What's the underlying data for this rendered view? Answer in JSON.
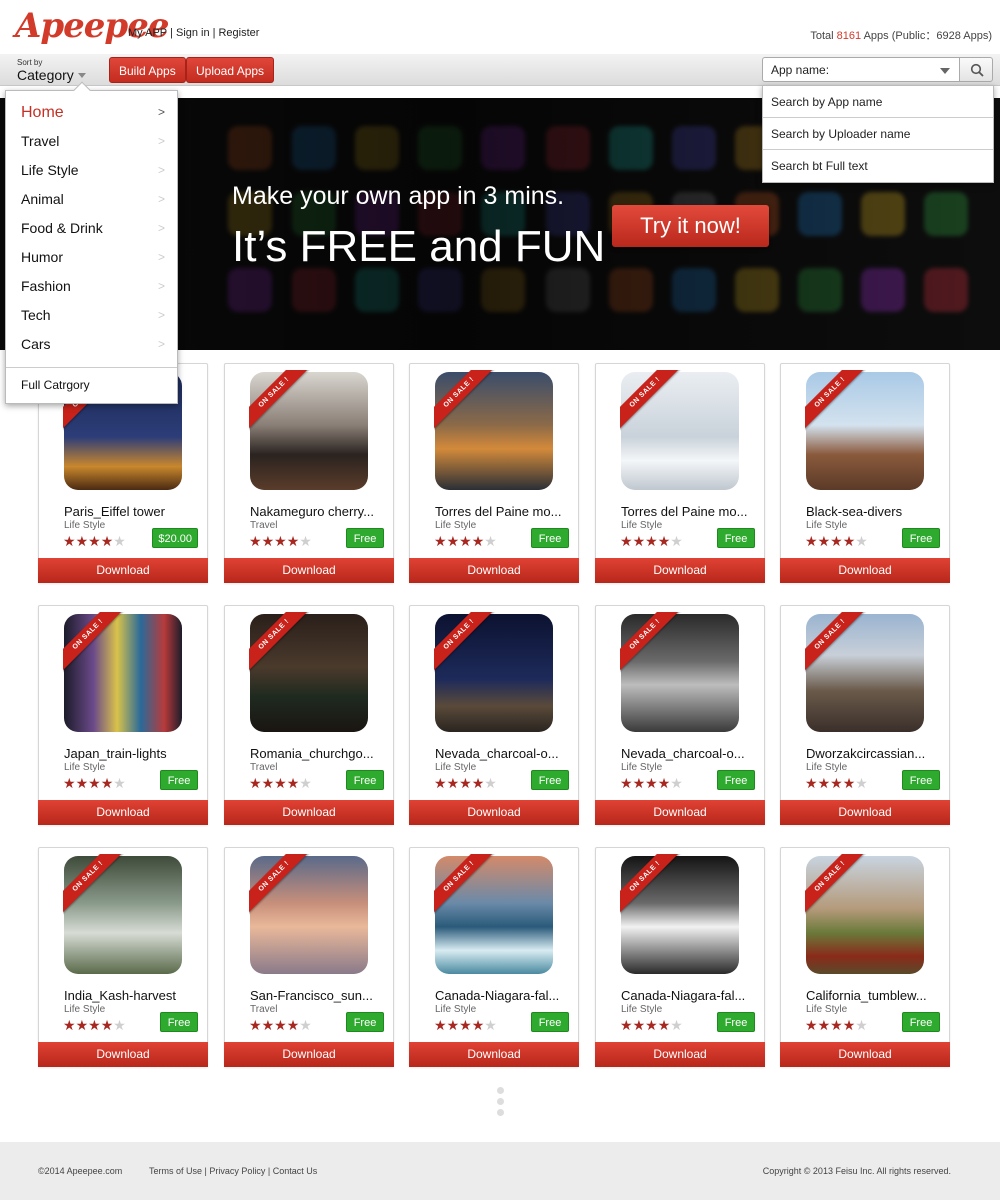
{
  "header": {
    "logo": "Apeepee",
    "links": [
      "My APP",
      "Sign in",
      "Register"
    ],
    "total_prefix": "Total ",
    "total_count": "8161",
    "total_suffix": " Apps (Public：6928 Apps)"
  },
  "toolbar": {
    "sort_label": "Sort by",
    "sort_value": "Category",
    "build_label": "Build Apps",
    "upload_label": "Upload Apps",
    "search_value": "App name:"
  },
  "hero": {
    "line1": "Make your own app in 3 mins.",
    "line2": "It’s FREE and FUN",
    "cta": "Try it now!"
  },
  "category_menu": {
    "items": [
      "Home",
      "Travel",
      "Life Style",
      "Animal",
      "Food & Drink",
      "Humor",
      "Fashion",
      "Tech",
      "Cars"
    ],
    "arrow": ">",
    "full": "Full Catrgory"
  },
  "search_menu": {
    "options": [
      "Search by App name",
      "Search by Uploader name",
      "Search bt Full text"
    ]
  },
  "ribbon_text": "ON SALE !",
  "download_label": "Download",
  "apps": [
    {
      "name": "Paris_Eiffel tower",
      "category": "Life Style",
      "rating": 4,
      "price": "$20.00"
    },
    {
      "name": "Nakameguro cherry...",
      "category": "Travel",
      "rating": 4,
      "price": "Free"
    },
    {
      "name": "Torres del Paine mo...",
      "category": "Life Style",
      "rating": 4,
      "price": "Free"
    },
    {
      "name": "Torres del Paine mo...",
      "category": "Life Style",
      "rating": 4,
      "price": "Free"
    },
    {
      "name": "Black-sea-divers",
      "category": "Life Style",
      "rating": 4,
      "price": "Free"
    },
    {
      "name": "Japan_train-lights",
      "category": "Life Style",
      "rating": 4,
      "price": "Free"
    },
    {
      "name": "Romania_churchgo...",
      "category": "Travel",
      "rating": 4,
      "price": "Free"
    },
    {
      "name": "Nevada_charcoal-o...",
      "category": "Life Style",
      "rating": 4,
      "price": "Free"
    },
    {
      "name": "Nevada_charcoal-o...",
      "category": "Life Style",
      "rating": 4,
      "price": "Free"
    },
    {
      "name": "Dworzakcircassian...",
      "category": "Life Style",
      "rating": 4,
      "price": "Free"
    },
    {
      "name": "India_Kash-harvest",
      "category": "Life Style",
      "rating": 4,
      "price": "Free"
    },
    {
      "name": "San-Francisco_sun...",
      "category": "Travel",
      "rating": 4,
      "price": "Free"
    },
    {
      "name": "Canada-Niagara-fal...",
      "category": "Life Style",
      "rating": 4,
      "price": "Free"
    },
    {
      "name": "Canada-Niagara-fal...",
      "category": "Life Style",
      "rating": 4,
      "price": "Free"
    },
    {
      "name": "California_tumblew...",
      "category": "Life Style",
      "rating": 4,
      "price": "Free"
    }
  ],
  "footer": {
    "copyright": "©2014 Apeepee.com",
    "links": [
      "Terms of Use",
      "Privacy Policy",
      "Contact Us"
    ],
    "right": "Copyright © 2013 Feisu Inc. All rights reserved."
  },
  "colors": {
    "brand_red": "#d23a2a",
    "price_green": "#2eaa2e",
    "star_on": "#a72820",
    "star_off": "#cfcfcf"
  }
}
